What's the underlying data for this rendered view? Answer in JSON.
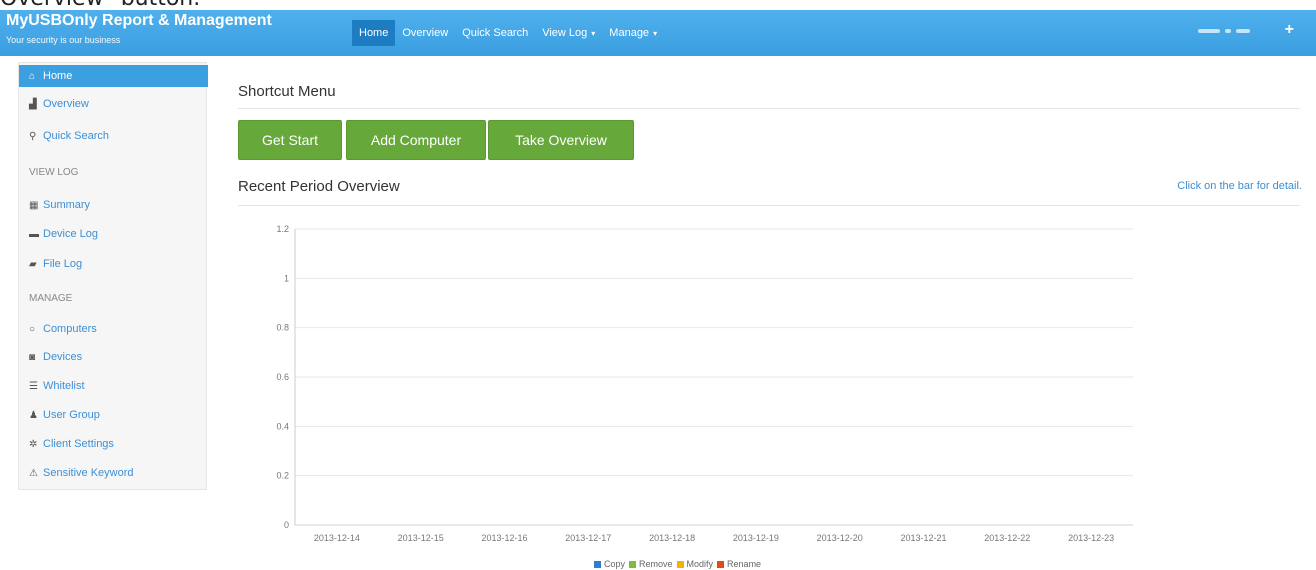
{
  "top_strip_text": "Overview\" button.",
  "brand": {
    "title": "MyUSBOnly Report & Management",
    "subtitle": "Your security is our business"
  },
  "nav": {
    "items": [
      {
        "label": "Home"
      },
      {
        "label": "Overview"
      },
      {
        "label": "Quick Search"
      },
      {
        "label": "View Log"
      },
      {
        "label": "Manage"
      }
    ]
  },
  "sidebar": {
    "items": [
      {
        "label": "Home",
        "icon": "home-icon"
      },
      {
        "label": "Overview",
        "icon": "bar-chart-icon"
      },
      {
        "label": "Quick Search",
        "icon": "search-icon"
      },
      {
        "label": "Summary",
        "icon": "grid-icon"
      },
      {
        "label": "Device Log",
        "icon": "hdd-icon"
      },
      {
        "label": "File Log",
        "icon": "folder-icon"
      },
      {
        "label": "Computers",
        "icon": "circle-icon"
      },
      {
        "label": "Devices",
        "icon": "camera-icon"
      },
      {
        "label": "Whitelist",
        "icon": "list-icon"
      },
      {
        "label": "User Group",
        "icon": "user-icon"
      },
      {
        "label": "Client Settings",
        "icon": "gear-icon"
      },
      {
        "label": "Sensitive Keyword",
        "icon": "warning-icon"
      }
    ],
    "headers": {
      "view_log": "VIEW LOG",
      "manage": "MANAGE"
    }
  },
  "main": {
    "shortcut_title": "Shortcut Menu",
    "buttons": {
      "get_start": "Get Start",
      "add_computer": "Add Computer",
      "take_overview": "Take Overview"
    },
    "overview_title": "Recent Period Overview",
    "detail_hint": "Click on the bar for detail."
  },
  "colors": {
    "navbar": "#3ea3e4",
    "button": "#67a83b",
    "copy": "#2a7fd0",
    "remove": "#7cbc3f",
    "modify": "#f0b400",
    "rename": "#e34a1a"
  },
  "chart_data": {
    "type": "bar",
    "categories": [
      "2013-12-14",
      "2013-12-15",
      "2013-12-16",
      "2013-12-17",
      "2013-12-18",
      "2013-12-19",
      "2013-12-20",
      "2013-12-21",
      "2013-12-22",
      "2013-12-23"
    ],
    "yticks": [
      "0",
      "0.2",
      "0.4",
      "0.6",
      "0.8",
      "1",
      "1.2"
    ],
    "ylim": [
      0,
      1.2
    ],
    "grid": true,
    "legend_position": "bottom",
    "series": [
      {
        "name": "Copy",
        "color": "#2a7fd0",
        "values": [
          0,
          0,
          0,
          0,
          0,
          0,
          0,
          0,
          0,
          0
        ]
      },
      {
        "name": "Remove",
        "color": "#7cbc3f",
        "values": [
          0,
          0,
          0,
          0,
          0,
          0,
          0,
          0,
          0,
          0
        ]
      },
      {
        "name": "Modify",
        "color": "#f0b400",
        "values": [
          0,
          0,
          0,
          0,
          0,
          0,
          0,
          0,
          0,
          0
        ]
      },
      {
        "name": "Rename",
        "color": "#e34a1a",
        "values": [
          0,
          0,
          0,
          0,
          0,
          0,
          0,
          0,
          0,
          0
        ]
      }
    ]
  }
}
